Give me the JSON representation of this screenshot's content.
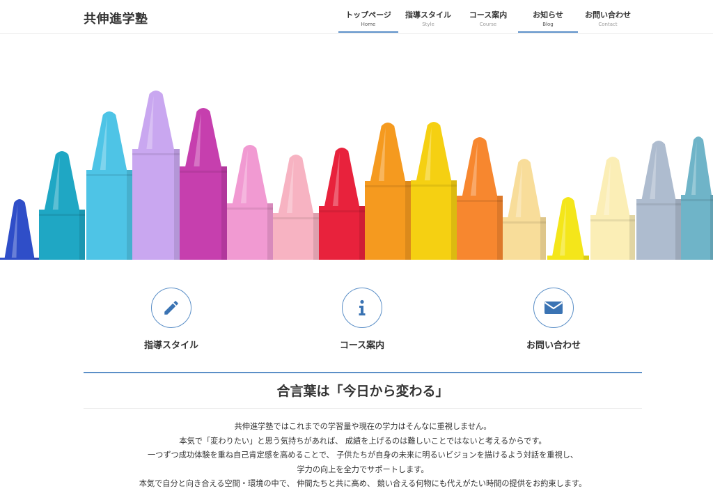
{
  "site": {
    "title": "共伸進学塾"
  },
  "nav": [
    {
      "label": "トップページ",
      "sub": "Home",
      "active": true
    },
    {
      "label": "指導スタイル",
      "sub": "Style",
      "active": false
    },
    {
      "label": "コース案内",
      "sub": "Course",
      "active": false
    },
    {
      "label": "お知らせ",
      "sub": "Blog",
      "active": true
    },
    {
      "label": "お問い合わせ",
      "sub": "Contact",
      "active": false
    }
  ],
  "hero": {
    "image": "crayons-image"
  },
  "features": [
    {
      "label": "指導スタイル",
      "icon": "pencil-icon"
    },
    {
      "label": "コース案内",
      "icon": "info-icon"
    },
    {
      "label": "お問い合わせ",
      "icon": "envelope-icon"
    }
  ],
  "section": {
    "title": "合言葉は「今日から変わる」",
    "paragraphs": [
      "共伸進学塾ではこれまでの学習量や現在の学力はそんなに重視しません。",
      "本気で「変わりたい」と思う気持ちがあれば、 成績を上げるのは難しいことではないと考えるからです。",
      "一つずつ成功体験を重ね自己肯定感を高めることで、 子供たちが自身の未来に明るいビジョンを描けるよう対話を重視し、",
      "学力の向上を全力でサポートします。",
      "本気で自分と向き合える空間・環境の中で、 仲間たちと共に高め、 競い合える何物にも代えがたい時間の提供をお約束します。"
    ]
  },
  "colors": {
    "accent": "#5b8fc7",
    "text": "#333333"
  }
}
